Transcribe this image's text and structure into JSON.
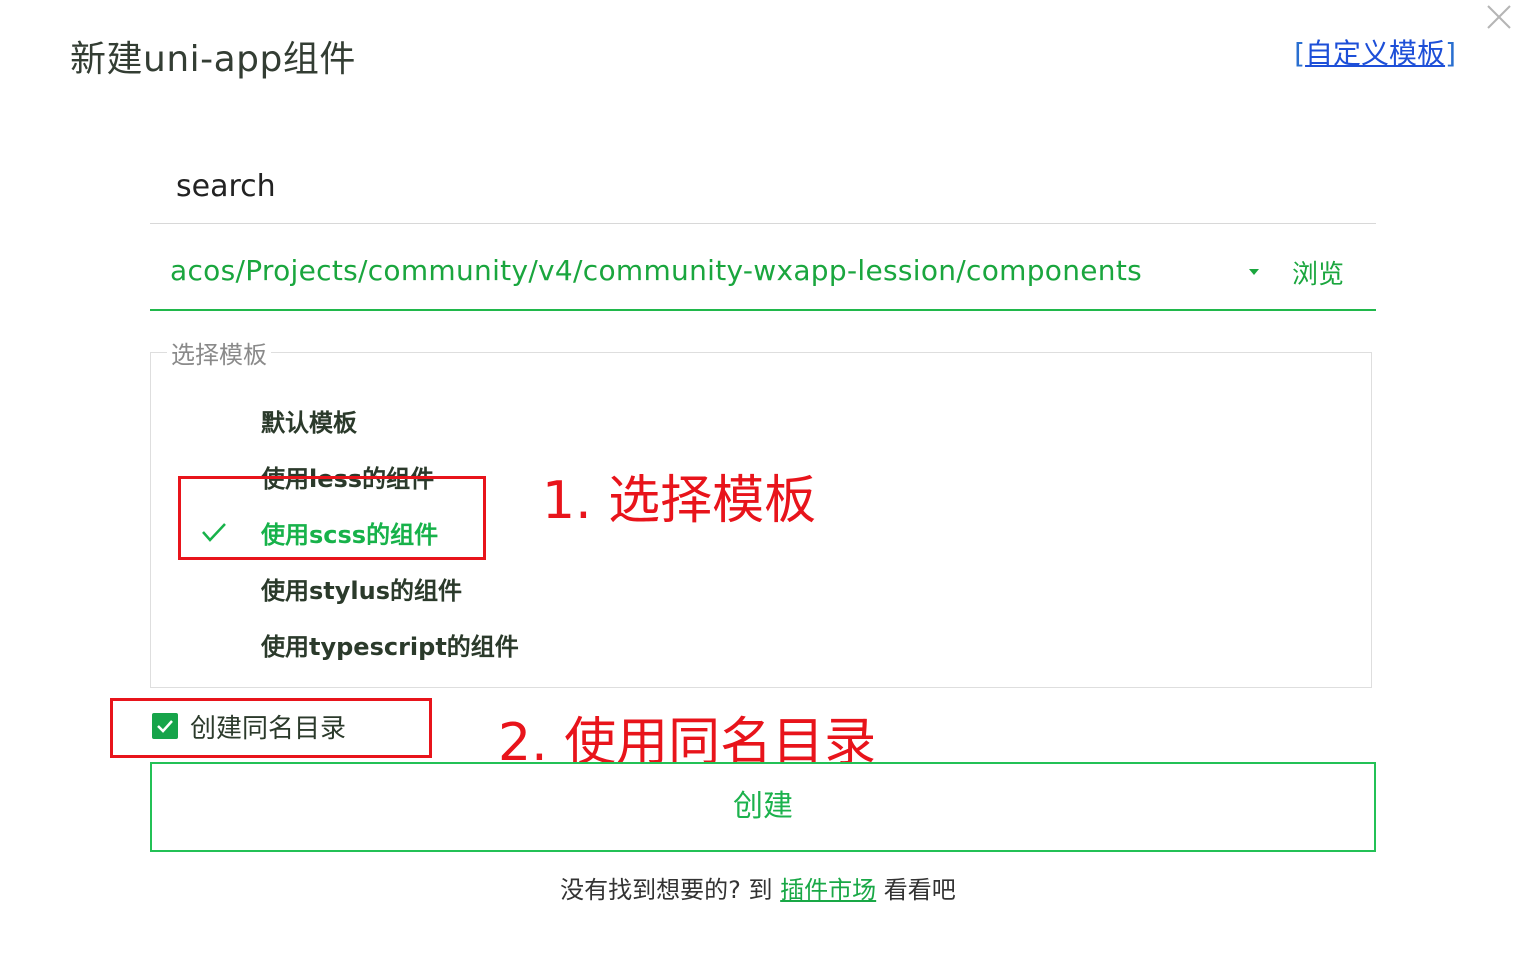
{
  "dialog": {
    "title": "新建uni-app组件",
    "custom_template": {
      "open_bracket": "[",
      "link_label": "自定义模板",
      "close_bracket": "]"
    },
    "close_icon": "close-icon"
  },
  "form": {
    "name_value": "search",
    "path_value": "acos/Projects/community/v4/community-wxapp-lession/components",
    "dropdown_icon": "caret-down-icon",
    "browse_label": "浏览"
  },
  "templates": {
    "legend": "选择模板",
    "items": [
      {
        "label": "默认模板",
        "selected": false
      },
      {
        "label": "使用less的组件",
        "selected": false
      },
      {
        "label": "使用scss的组件",
        "selected": true
      },
      {
        "label": "使用stylus的组件",
        "selected": false
      },
      {
        "label": "使用typescript的组件",
        "selected": false
      }
    ]
  },
  "options": {
    "create_same_dir": {
      "label": "创建同名目录",
      "checked": true
    }
  },
  "actions": {
    "create_label": "创建"
  },
  "footer": {
    "prefix": "没有找到想要的? 到 ",
    "link_label": "插件市场",
    "suffix": " 看看吧"
  },
  "annotations": {
    "step1": "1. 选择模板",
    "step2": "2. 使用同名目录"
  },
  "colors": {
    "accent_green": "#1aa63e",
    "annotation_red": "#e8141b",
    "link_blue": "#1d4fd8"
  }
}
